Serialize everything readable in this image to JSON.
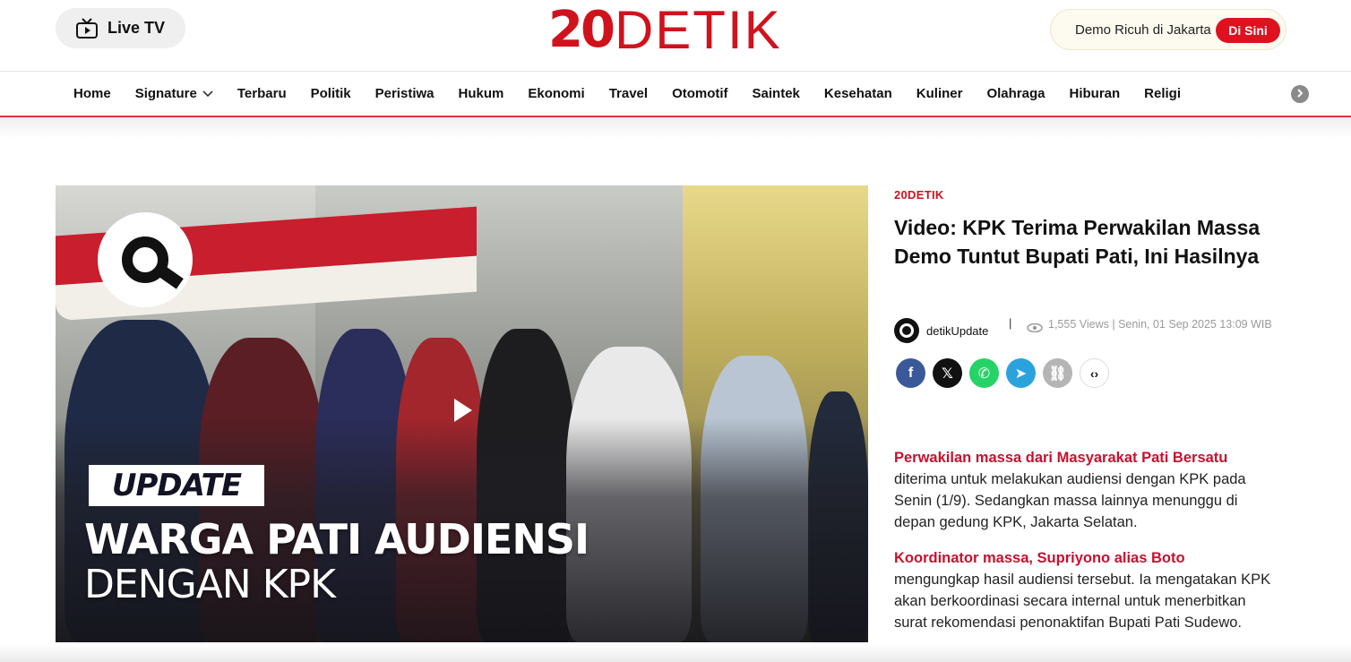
{
  "header": {
    "live_tv_label": "Live TV",
    "logo_num": "20",
    "logo_word": "DETIK",
    "promo_text": "Demo Ricuh di Jakarta",
    "promo_button": "Di Sini",
    "brand_color": "#d0121d"
  },
  "nav": {
    "items": [
      {
        "label": "Home"
      },
      {
        "label": "Signature"
      },
      {
        "label": "Terbaru"
      },
      {
        "label": "Politik"
      },
      {
        "label": "Peristiwa"
      },
      {
        "label": "Hukum"
      },
      {
        "label": "Ekonomi"
      },
      {
        "label": "Travel"
      },
      {
        "label": "Otomotif"
      },
      {
        "label": "Saintek"
      },
      {
        "label": "Kesehatan"
      },
      {
        "label": "Kuliner"
      },
      {
        "label": "Olahraga"
      },
      {
        "label": "Hiburan"
      },
      {
        "label": "Religi"
      }
    ]
  },
  "video": {
    "badge": "UPDATE",
    "headline_line1": "WARGA PATI AUDIENSI",
    "headline_line2": "DENGAN KPK"
  },
  "article": {
    "channel": "20DETIK",
    "title": "Video: KPK Terima Perwakilan Massa Demo Tuntut Bupati Pati, Ini Hasilnya",
    "author": "detikUpdate",
    "separator": "|",
    "views": "1,555 Views | Senin, 01 Sep 2025 13:09 WIB",
    "share": [
      {
        "name": "facebook",
        "color": "#3b5998",
        "glyph": "f"
      },
      {
        "name": "x",
        "color": "#111111",
        "glyph": "𝕏"
      },
      {
        "name": "whatsapp",
        "color": "#25d366",
        "glyph": "✆"
      },
      {
        "name": "telegram",
        "color": "#2aa3dd",
        "glyph": "➤"
      },
      {
        "name": "copy-link",
        "color": "#b5b5b5",
        "glyph": "⛓"
      },
      {
        "name": "embed",
        "color": "#ffffff",
        "glyph": "‹›"
      }
    ],
    "paragraphs": [
      {
        "lead": "Perwakilan massa dari Masyarakat Pati Bersatu",
        "text": "diterima untuk melakukan audiensi dengan KPK pada Senin (1/9). Sedangkan massa lainnya menunggu di depan gedung KPK, Jakarta Selatan."
      },
      {
        "lead": "Koordinator massa, Supriyono alias Boto",
        "text": "mengungkap hasil audiensi tersebut. Ia mengatakan KPK akan berkoordinasi secara internal untuk menerbitkan surat rekomendasi penonaktifan Bupati Pati Sudewo."
      }
    ]
  }
}
